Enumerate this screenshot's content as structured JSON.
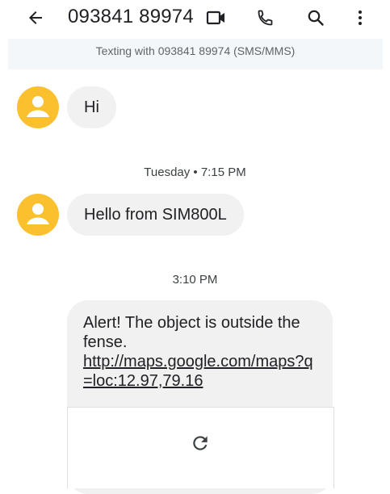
{
  "header": {
    "title": "093841 89974",
    "icons": [
      "back-arrow-icon",
      "video-call-icon",
      "phone-icon",
      "search-icon",
      "more-vert-icon"
    ]
  },
  "banner": {
    "text": "Texting with 093841 89974 (SMS/MMS)"
  },
  "messages": [
    {
      "text": "Hi"
    },
    {
      "timestamp": "Tuesday • 7:15 PM",
      "text": "Hello from SIM800L"
    },
    {
      "timestamp": "3:10 PM",
      "text": "Alert! The object is outside the fense.",
      "link": "http://maps.google.com/maps?q=loc:12.97,79.16"
    }
  ],
  "colors": {
    "avatar": "#fbc02d",
    "bubble": "#f1f1f1",
    "banner": "#f4f7fa"
  }
}
